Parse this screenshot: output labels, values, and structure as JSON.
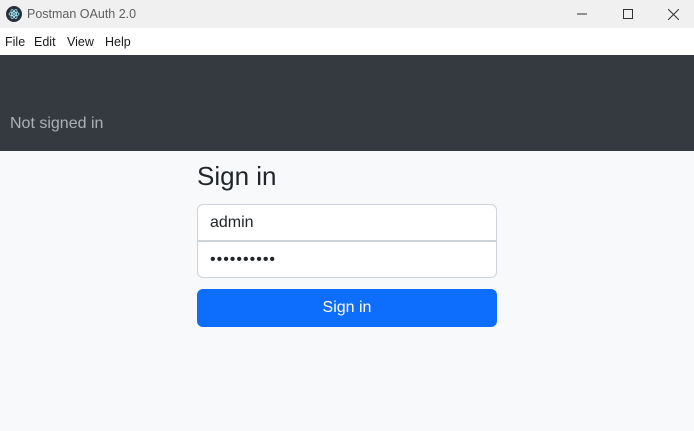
{
  "window": {
    "title": "Postman OAuth 2.0",
    "icon": "electron-logo-icon",
    "controls": [
      "minimize-icon",
      "maximize-icon",
      "close-icon"
    ]
  },
  "menu": {
    "items": [
      "File",
      "Edit",
      "View",
      "Help"
    ]
  },
  "navbar": {
    "status": "Not signed in"
  },
  "signin": {
    "heading": "Sign in",
    "username_value": "admin",
    "password_value": "••••••••••",
    "submit_label": "Sign in"
  },
  "colors": {
    "navbar_bg": "#343a40",
    "primary": "#0d6efd",
    "page_bg": "#f8f9fa"
  }
}
